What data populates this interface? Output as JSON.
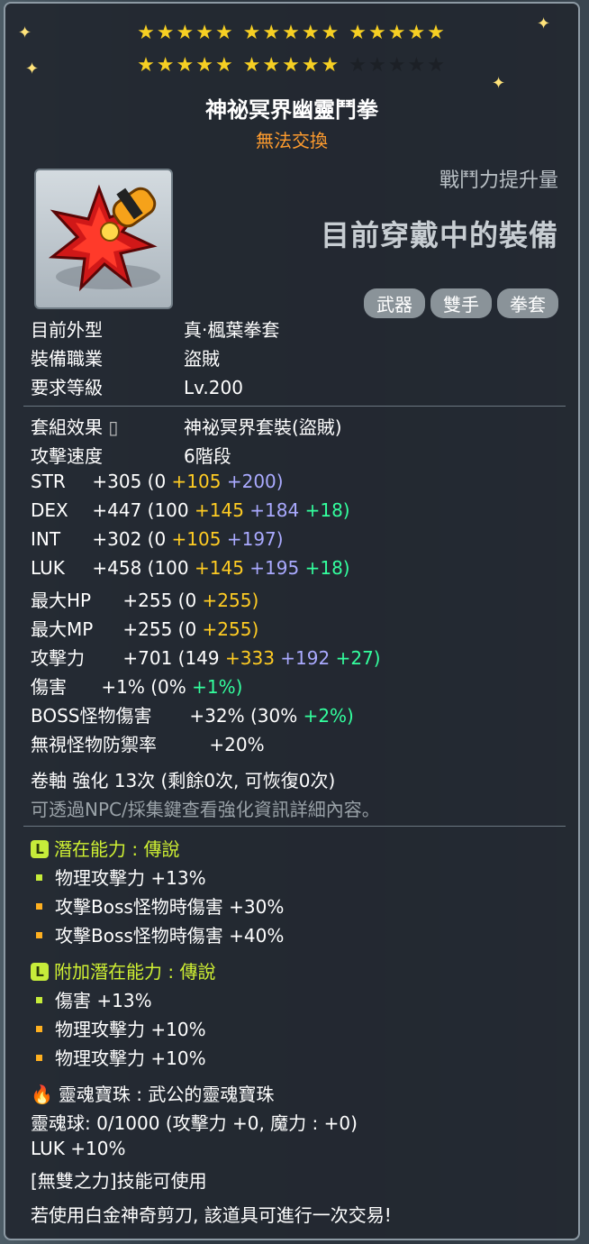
{
  "header": {
    "stars_row1": "★★★★★ ★★★★★ ★★★★★",
    "stars_row2_lit": "★★★★★ ★★★★★",
    "stars_row2_dim": "★★★★★",
    "item_name": "神祕冥界幽靈鬥拳",
    "tradeability": "無法交換"
  },
  "combat_power": {
    "label": "戰鬥力提升量",
    "value": "目前穿戴中的裝備"
  },
  "tags": [
    "武器",
    "雙手",
    "拳套"
  ],
  "basic": {
    "appearance_label": "目前外型",
    "appearance_value": "真·楓葉拳套",
    "job_label": "裝備職業",
    "job_value": "盜賊",
    "level_label": "要求等級",
    "level_value": "Lv.200",
    "set_label": "套組效果",
    "set_value": "神祕冥界套裝(盜賊)",
    "speed_label": "攻擊速度",
    "speed_value": "6階段"
  },
  "stats": {
    "str": {
      "name": "STR",
      "total": "+305",
      "base": "(0",
      "scroll": "+105",
      "star": "+200)"
    },
    "dex": {
      "name": "DEX",
      "total": "+447",
      "base": "(100",
      "flame": "+145",
      "star": "+184",
      "extra": "+18)"
    },
    "int": {
      "name": "INT",
      "total": "+302",
      "base": "(0",
      "scroll": "+105",
      "star": "+197)"
    },
    "luk": {
      "name": "LUK",
      "total": "+458",
      "base": "(100",
      "flame": "+145",
      "star": "+195",
      "extra": "+18)"
    },
    "hp": {
      "name": "最大HP",
      "total": "+255",
      "base": "(0",
      "flame": "+255)"
    },
    "mp": {
      "name": "最大MP",
      "total": "+255",
      "base": "(0",
      "flame": "+255)"
    },
    "att": {
      "name": "攻擊力",
      "total": "+701",
      "base": "(149",
      "flame": "+333",
      "star": "+192",
      "extra": "+27)"
    },
    "dmg": {
      "name": "傷害",
      "total": "+1%",
      "base": "(0%",
      "extra": "+1%)"
    },
    "boss": {
      "name": "BOSS怪物傷害",
      "total": "+32%",
      "base": "(30%",
      "extra": "+2%)"
    },
    "ied": {
      "name": "無視怪物防禦率",
      "total": "+20%"
    }
  },
  "enhance": {
    "line": "卷軸 強化 13次 (剩餘0次, 可恢復0次)",
    "hint": "可透過NPC/採集鍵查看強化資訊詳細內容。"
  },
  "potential": {
    "title": "潛在能力 : 傳說",
    "lines": [
      "物理攻擊力 +13%",
      "攻擊Boss怪物時傷害 +30%",
      "攻擊Boss怪物時傷害 +40%"
    ]
  },
  "additional": {
    "title": "附加潛在能力 : 傳說",
    "lines": [
      "傷害 +13%",
      "物理攻擊力 +10%",
      "物理攻擊力 +10%"
    ]
  },
  "soul": {
    "title": "靈魂寶珠 : 武公的靈魂寶珠",
    "orb": "靈魂球: 0/1000 (攻擊力 +0, 魔力 : +0)",
    "bonus": "LUK +10%",
    "skill": "[無雙之力]技能可使用"
  },
  "footer": "若使用白金神奇剪刀, 該道具可進行一次交易!",
  "badge_letter": "L",
  "colors": {
    "gold": "#ffcc23",
    "purple": "#aaaaff",
    "green": "#33ff9e",
    "legend": "#cff033",
    "orange": "#ff9c2e"
  }
}
